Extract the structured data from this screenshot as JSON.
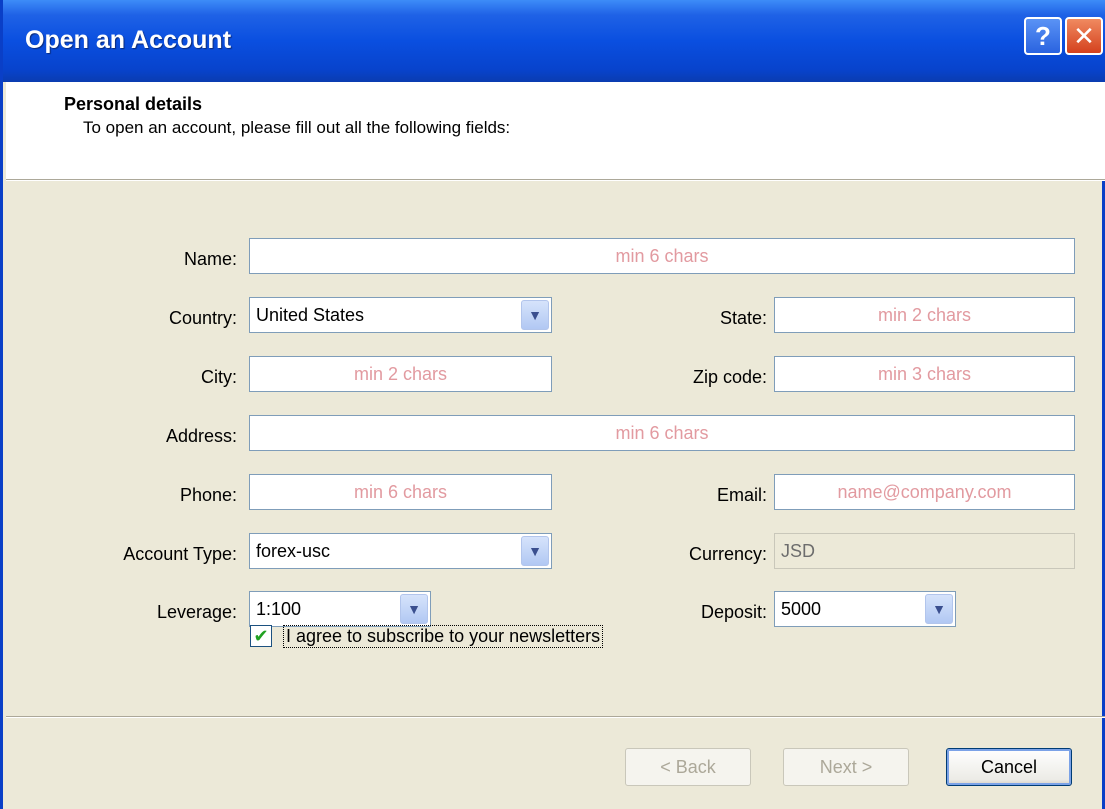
{
  "window": {
    "title": "Open an Account",
    "help_label": "?",
    "close_label": "✕"
  },
  "header": {
    "title": "Personal details",
    "subtitle": "To open an account, please fill out all the following fields:"
  },
  "form": {
    "name": {
      "label": "Name:",
      "placeholder": "min 6 chars"
    },
    "country": {
      "label": "Country:",
      "value": "United States"
    },
    "state": {
      "label": "State:",
      "placeholder": "min 2 chars"
    },
    "city": {
      "label": "City:",
      "placeholder": "min 2 chars"
    },
    "zip": {
      "label": "Zip code:",
      "placeholder": "min 3 chars"
    },
    "address": {
      "label": "Address:",
      "placeholder": "min 6 chars"
    },
    "phone": {
      "label": "Phone:",
      "placeholder": "min 6 chars"
    },
    "email": {
      "label": "Email:",
      "placeholder": "name@company.com"
    },
    "account_type": {
      "label": "Account Type:",
      "value": "forex-usc"
    },
    "currency": {
      "label": "Currency:",
      "value": "JSD"
    },
    "leverage": {
      "label": "Leverage:",
      "value": "1:100"
    },
    "deposit": {
      "label": "Deposit:",
      "value": "5000"
    },
    "newsletter": {
      "label": "I agree to subscribe to your newsletters",
      "checked": true
    }
  },
  "buttons": {
    "back": "< Back",
    "next": "Next >",
    "cancel": "Cancel"
  },
  "colors": {
    "titlebar": "#0a4fe0",
    "placeholder": "#e29aa0",
    "dialog_bg": "#ece9d8"
  }
}
